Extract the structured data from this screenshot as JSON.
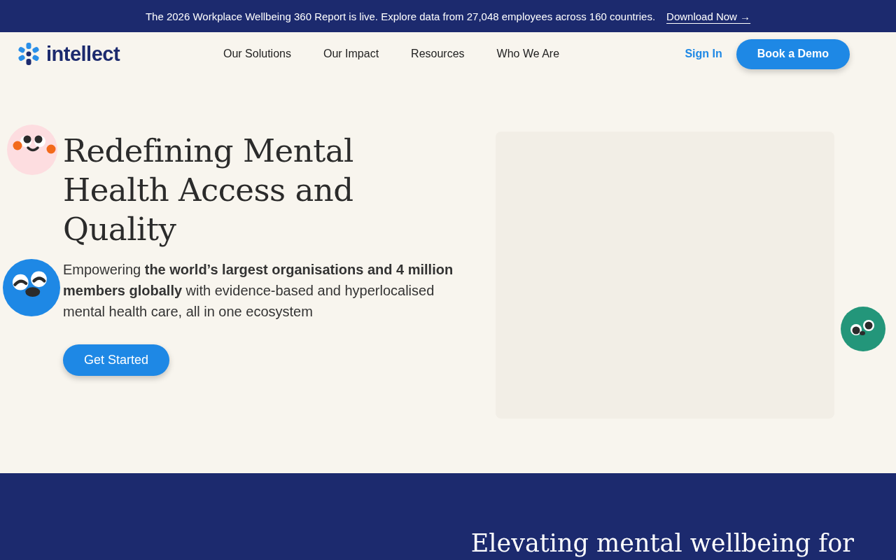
{
  "announcement": {
    "text": "The 2026 Workplace Wellbeing 360 Report is live. Explore data from 27,048 employees across 160 countries.",
    "link": "Download Now →"
  },
  "nav": {
    "logo": "intellect",
    "items": [
      "Our Solutions",
      "Our Impact",
      "Resources",
      "Who We Are"
    ],
    "sign_in": "Sign In",
    "cta": "Book a Demo"
  },
  "hero": {
    "heading": "Redefining Mental Health Access and Quality",
    "paragraph": "Empowering **the world’s largest organisations and 4 million members globally** with evidence-based and hyperlocalised mental health care, all in one ecosystem",
    "button": "Get Started"
  },
  "next_section": {
    "heading": "Elevating mental wellbeing for"
  }
}
